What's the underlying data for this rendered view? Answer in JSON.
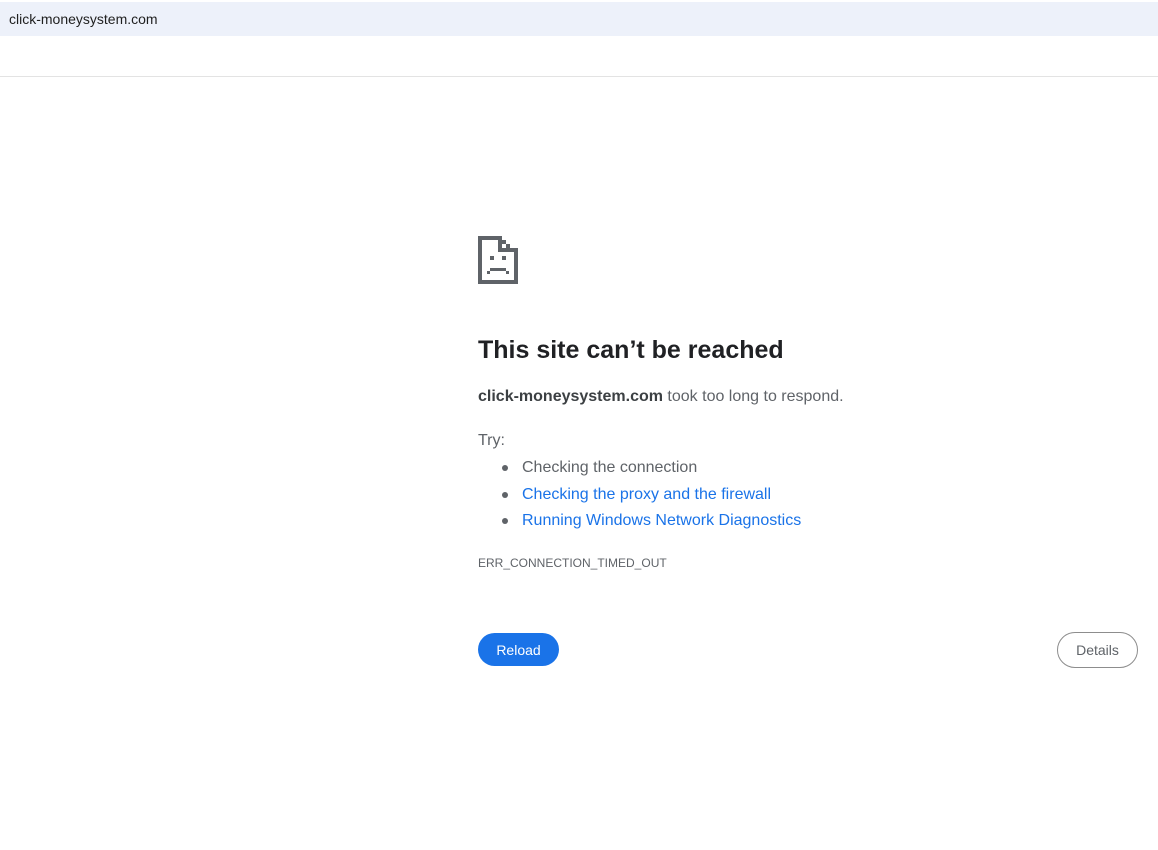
{
  "address_bar": {
    "url": "click-moneysystem.com"
  },
  "error_page": {
    "icon": "sad-page-icon",
    "title": "This site can’t be reached",
    "host": "click-moneysystem.com",
    "message_suffix": " took too long to respond.",
    "try_label": "Try:",
    "suggestions": [
      {
        "label": "Checking the connection",
        "is_link": false
      },
      {
        "label": "Checking the proxy and the firewall",
        "is_link": true
      },
      {
        "label": "Running Windows Network Diagnostics",
        "is_link": true
      }
    ],
    "error_code": "ERR_CONNECTION_TIMED_OUT",
    "reload_label": "Reload",
    "details_label": "Details"
  },
  "colors": {
    "accent": "#1a73e8",
    "address_bar_bg": "#edf1fa",
    "text_secondary": "#5f6368"
  }
}
